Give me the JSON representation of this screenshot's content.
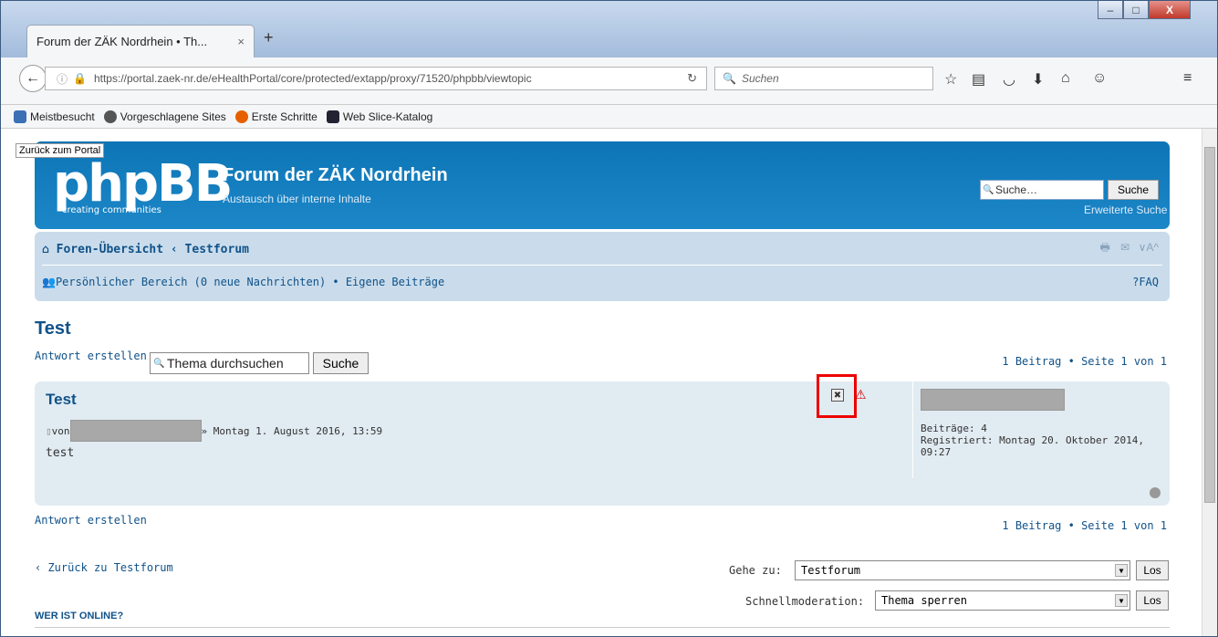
{
  "browser": {
    "tab_title": "Forum der ZÄK Nordrhein • Th...",
    "tab_close": "×",
    "new_tab": "+",
    "url": "https://portal.zaek-nr.de/eHealthPortal/core/protected/extapp/proxy/71520/phpbb/viewtopic",
    "search_placeholder": "Suchen",
    "window_buttons": {
      "minimize": "–",
      "maximize": "□",
      "close": "X"
    },
    "bookmarks": [
      {
        "label": "Meistbesucht",
        "color": "#3b6fb6"
      },
      {
        "label": "Vorgeschlagene Sites",
        "color": "#555"
      },
      {
        "label": "Erste Schritte",
        "color": "#e66000"
      },
      {
        "label": "Web Slice-Katalog",
        "color": "#223"
      }
    ]
  },
  "page": {
    "back_to_portal": "Zurück zum Portal",
    "logo_text": "phpBB",
    "logo_sub": "creating communities",
    "site_name": "Forum der ZÄK Nordrhein",
    "site_desc": "Austausch über interne Inhalte",
    "header_search_placeholder": "Suche…",
    "header_search_button": "Suche",
    "advanced_search": "Erweiterte Suche",
    "breadcrumb": "Foren-Übersicht ‹ Testforum",
    "personal_line": "Persönlicher Bereich (0 neue Nachrichten) • Eigene Beiträge",
    "faq": "FAQ",
    "topic_title": "Test",
    "reply_label": "Antwort erstellen",
    "topic_search_value": "Thema durchsuchen",
    "topic_search_button": "Suche",
    "pagination": "1 Beitrag • Seite 1 von 1",
    "post": {
      "title": "Test",
      "by": "von",
      "date": "» Montag 1. August 2016, 13:59",
      "body": "test",
      "profile_posts": "Beiträge: 4",
      "profile_registered": "Registriert: Montag 20. Oktober 2014, 09:27"
    },
    "back_to_forum": "‹ Zurück zu Testforum",
    "jump_label": "Gehe zu:",
    "jump_value": "Testforum",
    "jump_button": "Los",
    "mod_label": "Schnellmoderation:",
    "mod_value": "Thema sperren",
    "mod_button": "Los",
    "who_online": "WER IST ONLINE?"
  }
}
